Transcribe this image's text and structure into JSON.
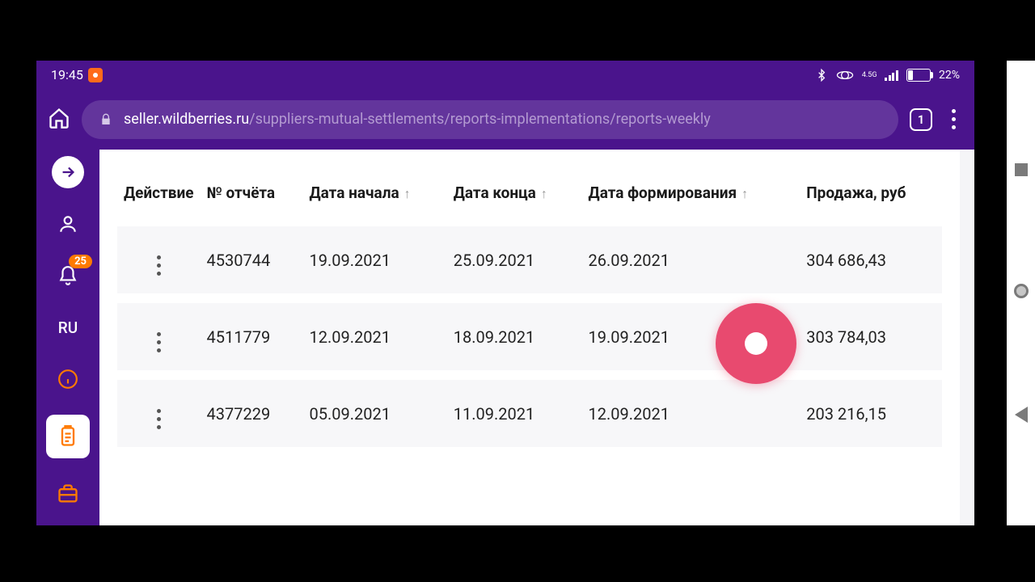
{
  "status": {
    "time": "19:45",
    "battery_pct": "22",
    "battery_suffix": "%",
    "net": "4.5G"
  },
  "browser": {
    "url_host": "seller.wildberries.ru",
    "url_path": "/suppliers-mutual-settlements/reports-implementations/reports-weekly",
    "tab_count": "1"
  },
  "sidebar": {
    "notif_badge": "25",
    "lang": "RU"
  },
  "table": {
    "headers": {
      "action": "Действие",
      "report_no": "№ отчёта",
      "date_start": "Дата начала",
      "date_end": "Дата конца",
      "date_formed": "Дата формирования",
      "sale_rub": "Продажа, руб"
    },
    "rows": [
      {
        "report_no": "4530744",
        "date_start": "19.09.2021",
        "date_end": "25.09.2021",
        "date_formed": "26.09.2021",
        "sale_rub": "304 686,43"
      },
      {
        "report_no": "4511779",
        "date_start": "12.09.2021",
        "date_end": "18.09.2021",
        "date_formed": "19.09.2021",
        "sale_rub": "303 784,03"
      },
      {
        "report_no": "4377229",
        "date_start": "05.09.2021",
        "date_end": "11.09.2021",
        "date_formed": "12.09.2021",
        "sale_rub": "203 216,15"
      }
    ]
  }
}
